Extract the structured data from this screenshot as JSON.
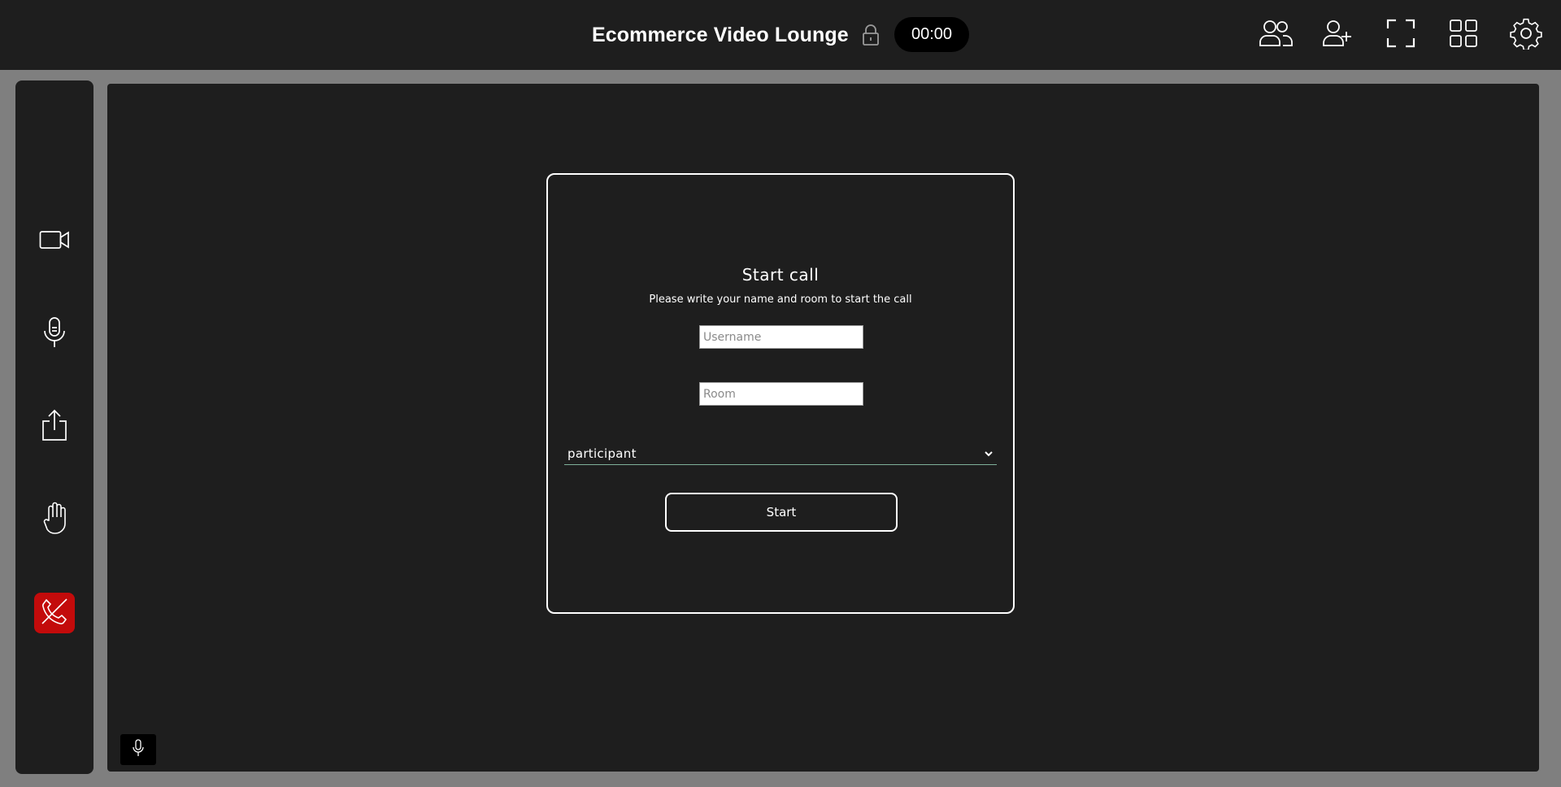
{
  "header": {
    "room_title": "Ecommerce Video Lounge",
    "timer": "00:00",
    "lock_icon": "lock-icon",
    "actions": [
      {
        "name": "participants",
        "icon": "participants-icon"
      },
      {
        "name": "add-participant",
        "icon": "add-user-icon"
      },
      {
        "name": "fullscreen",
        "icon": "fullscreen-icon"
      },
      {
        "name": "grid-layout",
        "icon": "grid-icon"
      },
      {
        "name": "settings",
        "icon": "gear-icon"
      }
    ]
  },
  "sidebar": {
    "items": [
      {
        "name": "camera",
        "icon": "video-camera-icon"
      },
      {
        "name": "microphone",
        "icon": "microphone-icon"
      },
      {
        "name": "share",
        "icon": "share-icon"
      },
      {
        "name": "raise-hand",
        "icon": "hand-icon"
      },
      {
        "name": "hang-up",
        "icon": "phone-hangup-icon"
      }
    ]
  },
  "dialog": {
    "title": "Start call",
    "subtitle": "Please write your name and room to start the call",
    "username_placeholder": "Username",
    "room_placeholder": "Room",
    "role_value": "participant",
    "start_label": "Start"
  },
  "colors": {
    "background": "#7f7f7f",
    "panel": "#1e1e1e",
    "hangup": "#c30b0b",
    "select_underline": "#7fb09a"
  }
}
